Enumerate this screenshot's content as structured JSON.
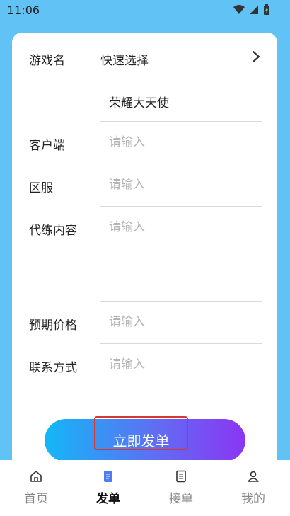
{
  "status": {
    "time": "11:06"
  },
  "form": {
    "game_name_label": "游戏名",
    "quick_select": "快速选择",
    "game_name_value": "荣耀大天使",
    "client_label": "客户端",
    "server_label": "区服",
    "content_label": "代练内容",
    "price_label": "预期价格",
    "contact_label": "联系方式",
    "placeholder": "请输入"
  },
  "submit": {
    "label": "立即发单"
  },
  "tabs": [
    {
      "label": "首页",
      "icon": "home-icon"
    },
    {
      "label": "发单",
      "icon": "post-order-icon"
    },
    {
      "label": "接单",
      "icon": "accept-order-icon"
    },
    {
      "label": "我的",
      "icon": "profile-icon"
    }
  ],
  "colors": {
    "background": "#61c2f6",
    "accent_start": "#13b8f6",
    "accent_end": "#8b35f3",
    "highlight": "#d6372f"
  }
}
